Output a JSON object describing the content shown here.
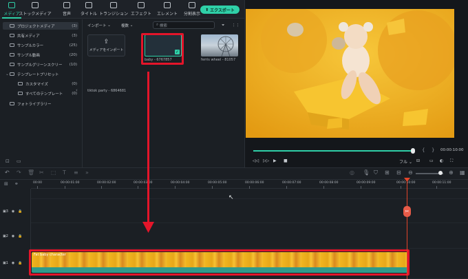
{
  "toolbar": {
    "tools": [
      {
        "label": "メディア",
        "icon": "media-icon"
      },
      {
        "label": "ストックメディア",
        "icon": "stock-media-icon"
      },
      {
        "label": "音声",
        "icon": "audio-icon"
      },
      {
        "label": "タイトル",
        "icon": "title-icon"
      },
      {
        "label": "トランジション",
        "icon": "transition-icon"
      },
      {
        "label": "エフェクト",
        "icon": "effect-icon"
      },
      {
        "label": "エレメント",
        "icon": "element-icon"
      },
      {
        "label": "分割表示",
        "icon": "split-screen-icon"
      }
    ],
    "export_label": "エクスポート"
  },
  "sidebar": {
    "items": [
      {
        "label": "プロジェクトメディア",
        "count": "(3)"
      },
      {
        "label": "共有メディア",
        "count": "(3)"
      },
      {
        "label": "サンプルカラー",
        "count": "(25)"
      },
      {
        "label": "サンプル動画",
        "count": "(20)"
      },
      {
        "label": "サンプルグリーンスクリー",
        "count": "(10)"
      },
      {
        "label": "テンプレートプリセット",
        "count": ""
      },
      {
        "label": "カスタマイズ",
        "count": "(0)"
      },
      {
        "label": "すべてのテンプレート",
        "count": "(0)"
      },
      {
        "label": "フォトライブラリー",
        "count": ""
      }
    ]
  },
  "media": {
    "import_dropdown": "インポート",
    "sort_dropdown": "複数",
    "search_placeholder": "検索",
    "import_card_label": "メディアをインポート",
    "items": [
      {
        "label": "baby - 6767857"
      },
      {
        "label": "ferris wheel - 81057"
      },
      {
        "label": "tiktok party - 6864681"
      }
    ]
  },
  "player": {
    "timecode": "00:00:10:00",
    "progress": 0.99,
    "quality_label": "フル"
  },
  "timeline": {
    "ruler_labels": [
      "00:00",
      "00:00:01:00",
      "00:00:02:00",
      "00:00:03:00",
      "00:00:04:00",
      "00:00:05:00",
      "00:00:06:00",
      "00:00:07:00",
      "00:00:08:00",
      "00:00:09:00",
      "00:00:10:00",
      "00:00:11:00"
    ],
    "tracks": [
      {
        "label": "3",
        "kind": "video"
      },
      {
        "label": "2",
        "kind": "video"
      },
      {
        "label": "1",
        "kind": "video"
      }
    ],
    "clip_title": "Fat baby character"
  }
}
